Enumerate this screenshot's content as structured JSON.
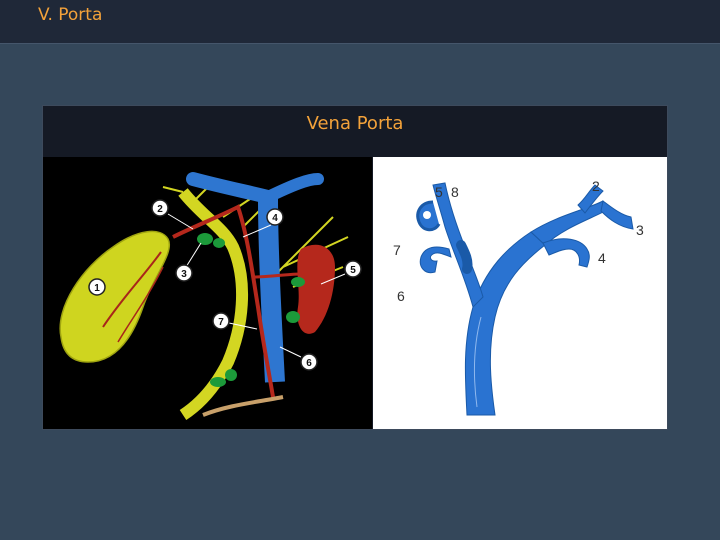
{
  "header": {
    "title": "V. Porta"
  },
  "panel": {
    "subtitle": "Vena Porta"
  },
  "anatomy_labels": [
    "1",
    "2",
    "3",
    "4",
    "5",
    "6",
    "7"
  ],
  "diagram_labels": [
    "2",
    "3",
    "4",
    "5",
    "6",
    "7",
    "8"
  ],
  "colors": {
    "title_accent": "#f3a23a",
    "vein_blue": "#2a73d1",
    "liver_yellow": "#d8df22",
    "artery_red": "#b5281c",
    "node_green": "#1c9a3a"
  }
}
